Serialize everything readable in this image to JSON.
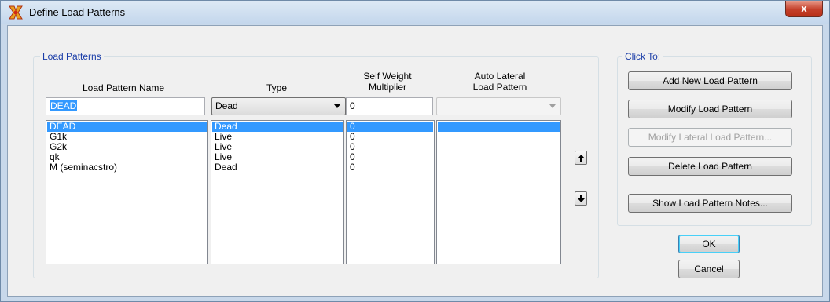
{
  "window": {
    "title": "Define Load Patterns",
    "close_label": "x"
  },
  "load_patterns": {
    "group_label": "Load Patterns",
    "headers": {
      "name": "Load Pattern Name",
      "type": "Type",
      "self_weight": [
        "Self Weight",
        "Multiplier"
      ],
      "auto_lateral": [
        "Auto Lateral",
        "Load Pattern"
      ]
    },
    "edit": {
      "name_value": "DEAD",
      "type_value": "Dead",
      "self_weight_value": "0",
      "auto_lateral_value": ""
    },
    "rows": [
      {
        "name": "DEAD",
        "type": "Dead",
        "multiplier": "0",
        "auto_lateral": "",
        "selected": true
      },
      {
        "name": "G1k",
        "type": "Live",
        "multiplier": "0",
        "auto_lateral": "",
        "selected": false
      },
      {
        "name": "G2k",
        "type": "Live",
        "multiplier": "0",
        "auto_lateral": "",
        "selected": false
      },
      {
        "name": "qk",
        "type": "Live",
        "multiplier": "0",
        "auto_lateral": "",
        "selected": false
      },
      {
        "name": "M (seminacstro)",
        "type": "Dead",
        "multiplier": "0",
        "auto_lateral": "",
        "selected": false
      }
    ]
  },
  "click_to": {
    "group_label": "Click To:",
    "add_label": "Add New Load Pattern",
    "modify_label": "Modify Load Pattern",
    "modify_lateral_label": "Modify Lateral Load Pattern...",
    "delete_label": "Delete Load Pattern",
    "notes_label": "Show Load Pattern Notes..."
  },
  "footer": {
    "ok_label": "OK",
    "cancel_label": "Cancel"
  },
  "icons": {
    "app": "etabs-app-icon",
    "move_up": "arrow-up-icon",
    "move_down": "arrow-down-icon",
    "close": "close-icon"
  },
  "colors": {
    "selection": "#3399ff",
    "group_label": "#1a3da8",
    "close_button": "#c4402b"
  }
}
